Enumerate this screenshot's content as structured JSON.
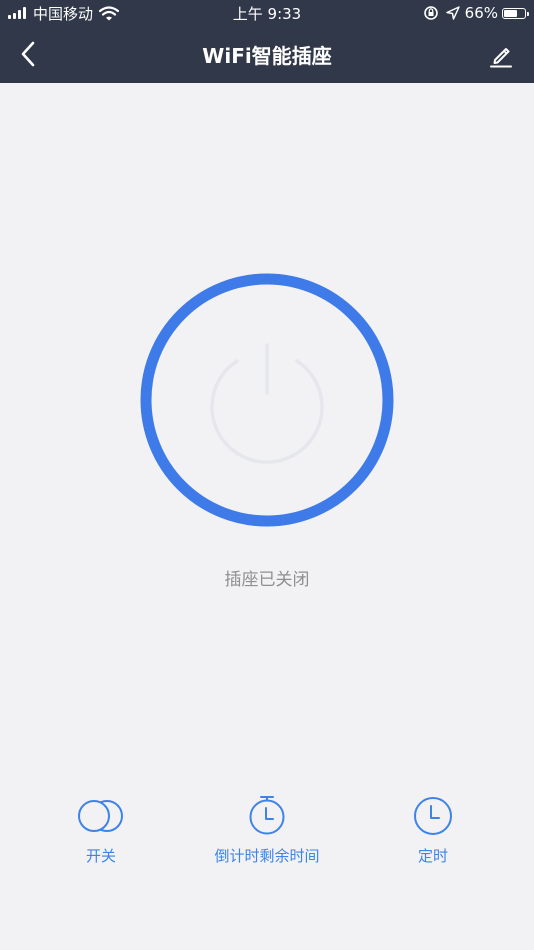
{
  "status_bar": {
    "carrier": "中国移动",
    "time": "上午 9:33",
    "battery_percent": "66%",
    "battery_level": 0.66
  },
  "nav": {
    "title": "WiFi智能插座",
    "back_icon": "chevron-left-icon",
    "edit_icon": "pencil-icon"
  },
  "power": {
    "status_text": "插座已关闭",
    "ring_color": "#3e7be8",
    "icon": "power-icon"
  },
  "bottom_actions": [
    {
      "label": "开关",
      "icon": "switch-toggle-icon"
    },
    {
      "label": "倒计时剩余时间",
      "icon": "stopwatch-icon"
    },
    {
      "label": "定时",
      "icon": "clock-icon"
    }
  ],
  "colors": {
    "header_bg": "#313849",
    "page_bg": "#f2f2f4",
    "accent": "#3e83e8",
    "status_text": "#8f8f8f"
  }
}
